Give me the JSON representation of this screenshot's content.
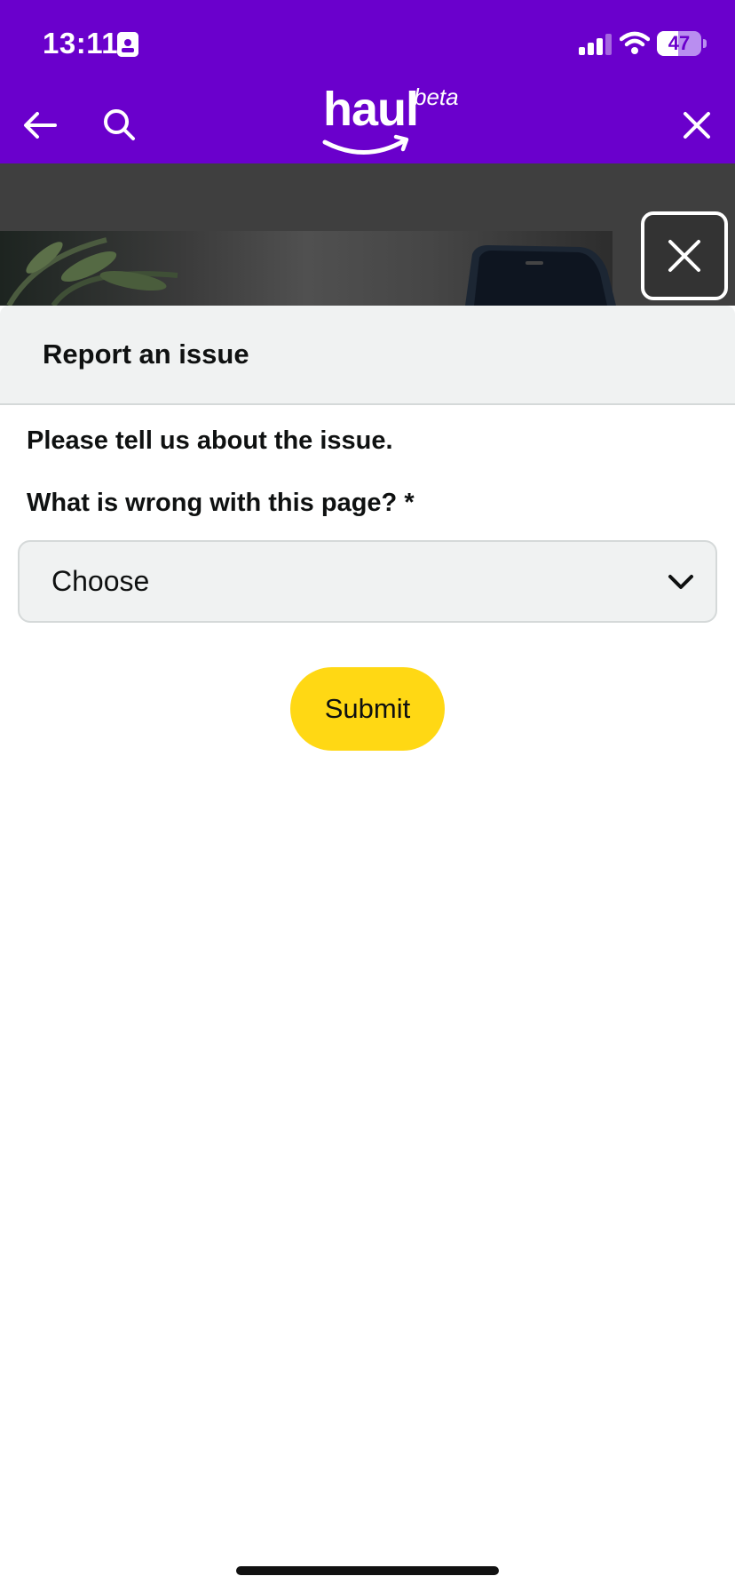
{
  "status_bar": {
    "time": "13:11",
    "battery_level": "47",
    "battery_fraction": 0.47,
    "icons": [
      "id-card-icon",
      "cellular-signal-icon",
      "wifi-icon",
      "battery-icon"
    ]
  },
  "header": {
    "logo_word": "haul",
    "logo_badge": "beta",
    "background_color": "#6a00cc",
    "icons": [
      "back-arrow-icon",
      "search-icon",
      "close-icon"
    ]
  },
  "overlay": {
    "close_icon": "close-icon"
  },
  "report_sheet": {
    "title": "Report an issue",
    "intro": "Please tell us about the issue.",
    "question_label": "What is wrong with this page? *",
    "select": {
      "selected": "Choose",
      "icon": "chevron-down-icon"
    },
    "submit_label": "Submit",
    "submit_color": "#ffd814"
  }
}
